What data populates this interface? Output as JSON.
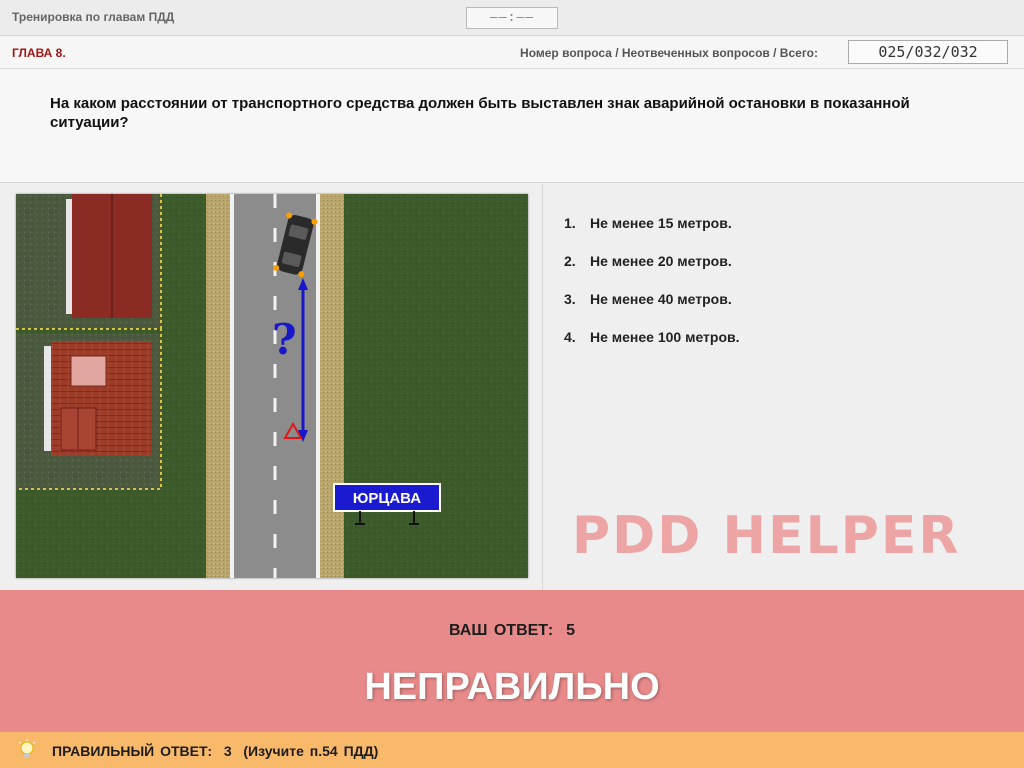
{
  "header": {
    "title": "Тренировка по главам ПДД",
    "timer": "——:——"
  },
  "status": {
    "chapter": "ГЛАВА 8.",
    "counter_label": "Номер вопроса / Неотвеченных вопросов / Всего:",
    "counter_value": "025/032/032"
  },
  "question": {
    "text": "На каком расстоянии от транспортного средства должен быть выставлен знак аварийной остановки в показанной ситуации?"
  },
  "scene": {
    "question_mark": "?",
    "town_sign": "ЮРЦАВА",
    "colors": {
      "grass": "#3e5a2a",
      "road": "#8b8b8b",
      "shoulder": "#b8a46a",
      "roof": "#8a2c24",
      "sign": "#1a1ad0",
      "arrow": "#1818c8"
    }
  },
  "answers": [
    {
      "num": "1.",
      "text": "Не менее 15 метров."
    },
    {
      "num": "2.",
      "text": "Не менее 20 метров."
    },
    {
      "num": "3.",
      "text": "Не менее 40 метров."
    },
    {
      "num": "4.",
      "text": "Не менее 100 метров."
    }
  ],
  "watermark": "PDD HELPER",
  "result": {
    "your_answer_label": "ВАШ  ОТВЕТ:",
    "your_answer_value": "5",
    "verdict": "НЕПРАВИЛЬНО",
    "color": "#e98a8a"
  },
  "footer": {
    "icon": "lightbulb-icon",
    "correct_label": "ПРАВИЛЬНЫЙ ОТВЕТ:",
    "correct_value": "3",
    "reference": "(Изучите п.54 ПДД)",
    "color": "#f9b96b"
  }
}
